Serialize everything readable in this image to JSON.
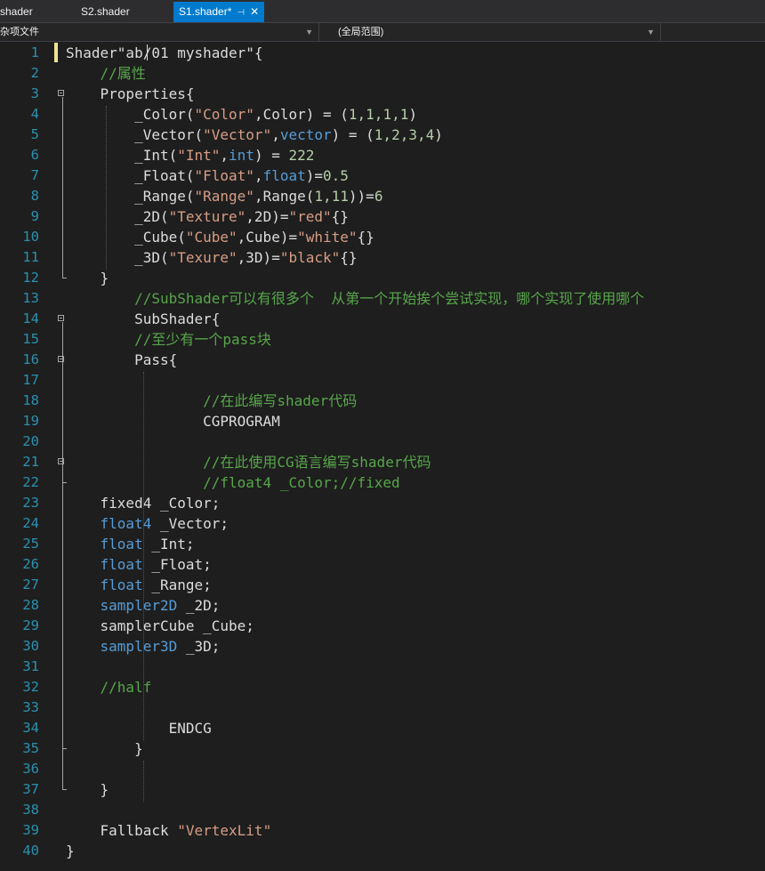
{
  "tabs": [
    {
      "label": "shader",
      "active": false
    },
    {
      "label": "S2.shader",
      "active": false
    },
    {
      "label": "S1.shader*",
      "active": true,
      "pin_icon": "pin-icon",
      "close_icon": "close-icon"
    }
  ],
  "navbar": {
    "project_dropdown": "杂项文件",
    "scope_dropdown": "(全局范围)"
  },
  "colors": {
    "background": "#1e1e1e",
    "line_number": "#2b91af",
    "comment": "#57a64a",
    "string": "#d69d85",
    "keyword": "#569cd6",
    "number": "#b5cea8",
    "text": "#dcdcdc",
    "active_tab": "#007acc"
  },
  "lines": [
    {
      "n": "1",
      "t": [
        [
          "Shader\"ab/01 myshader\"{",
          ""
        ]
      ]
    },
    {
      "n": "2",
      "t": [
        [
          "    ",
          ""
        ],
        [
          "//属性",
          "c"
        ]
      ]
    },
    {
      "n": "3",
      "t": [
        [
          "    Properties{",
          ""
        ]
      ]
    },
    {
      "n": "4",
      "t": [
        [
          "        _Color(",
          ""
        ],
        [
          "\"Color\"",
          "s"
        ],
        [
          ",Color) = (",
          ""
        ],
        [
          "1,1,1,1",
          "n"
        ],
        [
          ")",
          ""
        ]
      ]
    },
    {
      "n": "5",
      "t": [
        [
          "        _Vector(",
          ""
        ],
        [
          "\"Vector\"",
          "s"
        ],
        [
          ",",
          ""
        ],
        [
          "vector",
          "k"
        ],
        [
          ") = (",
          ""
        ],
        [
          "1,2,3,4",
          "n"
        ],
        [
          ")",
          ""
        ]
      ]
    },
    {
      "n": "6",
      "t": [
        [
          "        _Int(",
          ""
        ],
        [
          "\"Int\"",
          "s"
        ],
        [
          ",",
          ""
        ],
        [
          "int",
          "k"
        ],
        [
          ") = ",
          ""
        ],
        [
          "222",
          "n"
        ]
      ]
    },
    {
      "n": "7",
      "t": [
        [
          "        _Float(",
          ""
        ],
        [
          "\"Float\"",
          "s"
        ],
        [
          ",",
          ""
        ],
        [
          "float",
          "k"
        ],
        [
          ")=",
          ""
        ],
        [
          "0.5",
          "n"
        ]
      ]
    },
    {
      "n": "8",
      "t": [
        [
          "        _Range(",
          ""
        ],
        [
          "\"Range\"",
          "s"
        ],
        [
          ",Range(",
          ""
        ],
        [
          "1,11",
          "n"
        ],
        [
          "))=",
          ""
        ],
        [
          "6",
          "n"
        ]
      ]
    },
    {
      "n": "9",
      "t": [
        [
          "        _2D(",
          ""
        ],
        [
          "\"Texture\"",
          "s"
        ],
        [
          ",2D)=",
          ""
        ],
        [
          "\"red\"",
          "s"
        ],
        [
          "{}",
          ""
        ]
      ]
    },
    {
      "n": "10",
      "t": [
        [
          "        _Cube(",
          ""
        ],
        [
          "\"Cube\"",
          "s"
        ],
        [
          ",Cube)=",
          ""
        ],
        [
          "\"white\"",
          "s"
        ],
        [
          "{}",
          ""
        ]
      ]
    },
    {
      "n": "11",
      "t": [
        [
          "        _3D(",
          ""
        ],
        [
          "\"Texure\"",
          "s"
        ],
        [
          ",3D)=",
          ""
        ],
        [
          "\"black\"",
          "s"
        ],
        [
          "{}",
          ""
        ]
      ]
    },
    {
      "n": "12",
      "t": [
        [
          "    }",
          ""
        ]
      ]
    },
    {
      "n": "13",
      "t": [
        [
          "        ",
          ""
        ],
        [
          "//SubShader可以有很多个  从第一个开始挨个尝试实现，哪个实现了使用哪个",
          "c"
        ]
      ]
    },
    {
      "n": "14",
      "t": [
        [
          "        SubShader{",
          ""
        ]
      ]
    },
    {
      "n": "15",
      "t": [
        [
          "        ",
          ""
        ],
        [
          "//至少有一个pass块",
          "c"
        ]
      ]
    },
    {
      "n": "16",
      "t": [
        [
          "        Pass{",
          ""
        ]
      ]
    },
    {
      "n": "17",
      "t": [
        [
          "",
          ""
        ]
      ]
    },
    {
      "n": "18",
      "t": [
        [
          "                ",
          ""
        ],
        [
          "//在此编写shader代码",
          "c"
        ]
      ]
    },
    {
      "n": "19",
      "t": [
        [
          "                CGPROGRAM",
          ""
        ]
      ]
    },
    {
      "n": "20",
      "t": [
        [
          "",
          ""
        ]
      ]
    },
    {
      "n": "21",
      "t": [
        [
          "                ",
          ""
        ],
        [
          "//在此使用CG语言编写shader代码",
          "c"
        ]
      ]
    },
    {
      "n": "22",
      "t": [
        [
          "                ",
          ""
        ],
        [
          "//float4 _Color;//fixed",
          "c"
        ]
      ]
    },
    {
      "n": "23",
      "t": [
        [
          "    fixed4 _Color;",
          ""
        ]
      ]
    },
    {
      "n": "24",
      "t": [
        [
          "    ",
          ""
        ],
        [
          "float4",
          "k"
        ],
        [
          " _Vector;",
          ""
        ]
      ]
    },
    {
      "n": "25",
      "t": [
        [
          "    ",
          ""
        ],
        [
          "float",
          "k"
        ],
        [
          " _Int;",
          ""
        ]
      ]
    },
    {
      "n": "26",
      "t": [
        [
          "    ",
          ""
        ],
        [
          "float",
          "k"
        ],
        [
          " _Float;",
          ""
        ]
      ]
    },
    {
      "n": "27",
      "t": [
        [
          "    ",
          ""
        ],
        [
          "float",
          "k"
        ],
        [
          " _Range;",
          ""
        ]
      ]
    },
    {
      "n": "28",
      "t": [
        [
          "    ",
          ""
        ],
        [
          "sampler2D",
          "k"
        ],
        [
          " _2D;",
          ""
        ]
      ]
    },
    {
      "n": "29",
      "t": [
        [
          "    samplerCube _Cube;",
          ""
        ]
      ]
    },
    {
      "n": "30",
      "t": [
        [
          "    ",
          ""
        ],
        [
          "sampler3D",
          "k"
        ],
        [
          " _3D;",
          ""
        ]
      ]
    },
    {
      "n": "31",
      "t": [
        [
          "",
          ""
        ]
      ]
    },
    {
      "n": "32",
      "t": [
        [
          "    ",
          ""
        ],
        [
          "//half",
          "c"
        ]
      ]
    },
    {
      "n": "33",
      "t": [
        [
          "",
          ""
        ]
      ]
    },
    {
      "n": "34",
      "t": [
        [
          "            ENDCG",
          ""
        ]
      ]
    },
    {
      "n": "35",
      "t": [
        [
          "        }",
          ""
        ]
      ]
    },
    {
      "n": "36",
      "t": [
        [
          "",
          ""
        ]
      ]
    },
    {
      "n": "37",
      "t": [
        [
          "    }",
          ""
        ]
      ]
    },
    {
      "n": "38",
      "t": [
        [
          "",
          ""
        ]
      ]
    },
    {
      "n": "39",
      "t": [
        [
          "    Fallback ",
          ""
        ],
        [
          "\"VertexLit\"",
          "s"
        ]
      ]
    },
    {
      "n": "40",
      "t": [
        [
          "}",
          ""
        ]
      ]
    }
  ],
  "fold_lines": [
    "3",
    "14",
    "16",
    "21"
  ]
}
